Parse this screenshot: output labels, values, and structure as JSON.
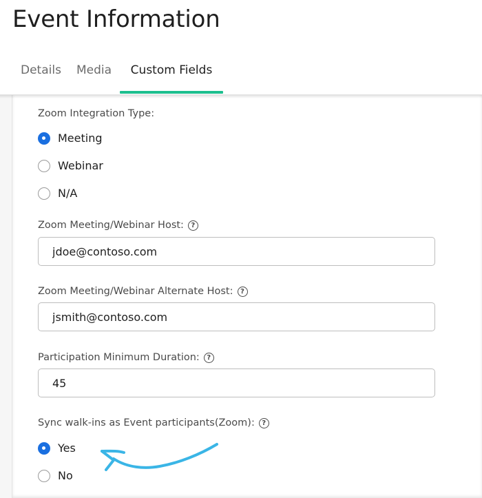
{
  "page": {
    "title": "Event Information"
  },
  "tabs": [
    {
      "label": "Details"
    },
    {
      "label": "Media"
    },
    {
      "label": "Custom Fields",
      "active": true
    }
  ],
  "form": {
    "zoom_type": {
      "label": "Zoom Integration Type:",
      "options": [
        "Meeting",
        "Webinar",
        "N/A"
      ],
      "selected": "Meeting"
    },
    "host": {
      "label": "Zoom Meeting/Webinar Host:",
      "value": "jdoe@contoso.com"
    },
    "alt_host": {
      "label": "Zoom Meeting/Webinar Alternate Host:",
      "value": "jsmith@contoso.com"
    },
    "min_duration": {
      "label": "Participation Minimum Duration:",
      "value": "45"
    },
    "sync_walkins": {
      "label": "Sync walk-ins as Event participants(Zoom):",
      "options": [
        "Yes",
        "No"
      ],
      "selected": "Yes"
    },
    "help_glyph": "?"
  },
  "colors": {
    "accent_tab": "#1dbf8f",
    "radio_checked": "#1a6fe0",
    "annotation_arrow": "#3ab5e6"
  },
  "icons": {
    "help": "question-circle-icon",
    "annotation": "hand-drawn-arrow"
  }
}
